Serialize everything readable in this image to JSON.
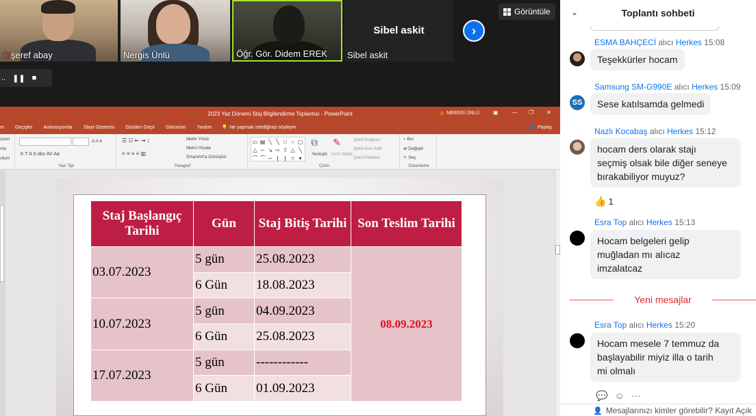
{
  "meeting": {
    "participants": [
      {
        "name": "şeref abay",
        "muted": true
      },
      {
        "name": "Nergis Ünlü",
        "muted": false
      },
      {
        "name": "Öğr. Gör. Didem EREK",
        "muted": false
      },
      {
        "name": "Sibel askit",
        "muted": false
      }
    ],
    "view_label": "Görüntüle",
    "share_bar": {
      "dots": "..",
      "pause": "❚❚",
      "stop": "■"
    }
  },
  "ppt": {
    "window_title": "2023 Yaz Dönemi Staj Bilgilendirme Toplantısı  -  PowerPoint",
    "user": "NERGİS ÜNLÜ",
    "tabs": [
      "m",
      "Geçişler",
      "Animasyonlar",
      "Slayt Gösterisi",
      "Gözden Geçir",
      "Görünüm",
      "Yardım"
    ],
    "tell_me": "Ne yapmak istediğinizi söyleyin",
    "share": "Paylaş",
    "ribbon": {
      "left_items": [
        "üzen",
        "ırla",
        "olum"
      ],
      "font_group": "Yazı Tipi",
      "font_tools": "K  T  A  S  abc  AV  Aa",
      "font_tools_top": "A  A  A",
      "paragraph_group": "Paragraf",
      "text_direction": "Metin Yönü",
      "align_text": "Metni Hizala",
      "smartart": "SmartArt'a Dönüştür",
      "drawing_group": "Çizim",
      "arrange": "Yerleştir",
      "quick_styles": "Hızlı Stiller",
      "shape_fill": "Şekil Dolgusu",
      "shape_outline": "Şekil Ana Hattı",
      "shape_effects": "Şekil Efektleri",
      "editing_group": "Düzenleme",
      "find": "Bul",
      "replace": "Değiştir",
      "select": "Seç"
    },
    "table": {
      "headers": [
        "Staj Başlangıç Tarihi",
        "Gün",
        "Staj Bitiş Tarihi",
        "Son Teslim Tarihi"
      ],
      "groups": [
        {
          "start": "03.07.2023",
          "rows": [
            {
              "days": "5 gün",
              "end": "25.08.2023"
            },
            {
              "days": "6 Gün",
              "end": "18.08.2023"
            }
          ]
        },
        {
          "start": "10.07.2023",
          "rows": [
            {
              "days": "5 gün",
              "end": "04.09.2023"
            },
            {
              "days": "6 Gün",
              "end": "25.08.2023"
            }
          ]
        },
        {
          "start": "17.07.2023",
          "rows": [
            {
              "days": "5 gün",
              "end": "------------"
            },
            {
              "days": "6 Gün",
              "end": "01.09.2023"
            }
          ]
        }
      ],
      "deadline": "08.09.2023"
    }
  },
  "chat": {
    "title": "Toplantı sohbeti",
    "recipient_word": "alıcı",
    "messages": [
      {
        "sender": "ESMA BAHÇECİ",
        "to": "Herkes",
        "time": "15:08",
        "text": "Teşekkürler hocam",
        "avatar": "photo1"
      },
      {
        "sender": "Samsung SM-G990E",
        "to": "Herkes",
        "time": "15:09",
        "text": "Sese katılsamda gelmedi",
        "avatar": "initials",
        "initials": "SS"
      },
      {
        "sender": "Nazlı Kocabaş",
        "to": "Herkes",
        "time": "15:12",
        "text_lines": [
          "hocam ders olarak stajı",
          "seçmiş olsak bile diğer seneye",
          "bırakabiliyor muyuz?"
        ],
        "avatar": "photo2"
      },
      {
        "sender": "Esra Top",
        "to": "Herkes",
        "time": "15:13",
        "text_lines": [
          "Hocam belgeleri gelip",
          "muğladan mı alıcaz",
          "imzalatcaz"
        ],
        "avatar": "black"
      },
      {
        "sender": "Esra Top",
        "to": "Herkes",
        "time": "15:20",
        "text_lines": [
          "Hocam mesele 7 temmuz da",
          "başlayabilir miyiz illa o tarih",
          "mi olmalı"
        ],
        "avatar": "black"
      }
    ],
    "reaction_count": "1",
    "new_messages_label": "Yeni mesajlar",
    "footer": "Mesajlarınızı kimler görebilir? Kayıt Açık"
  }
}
